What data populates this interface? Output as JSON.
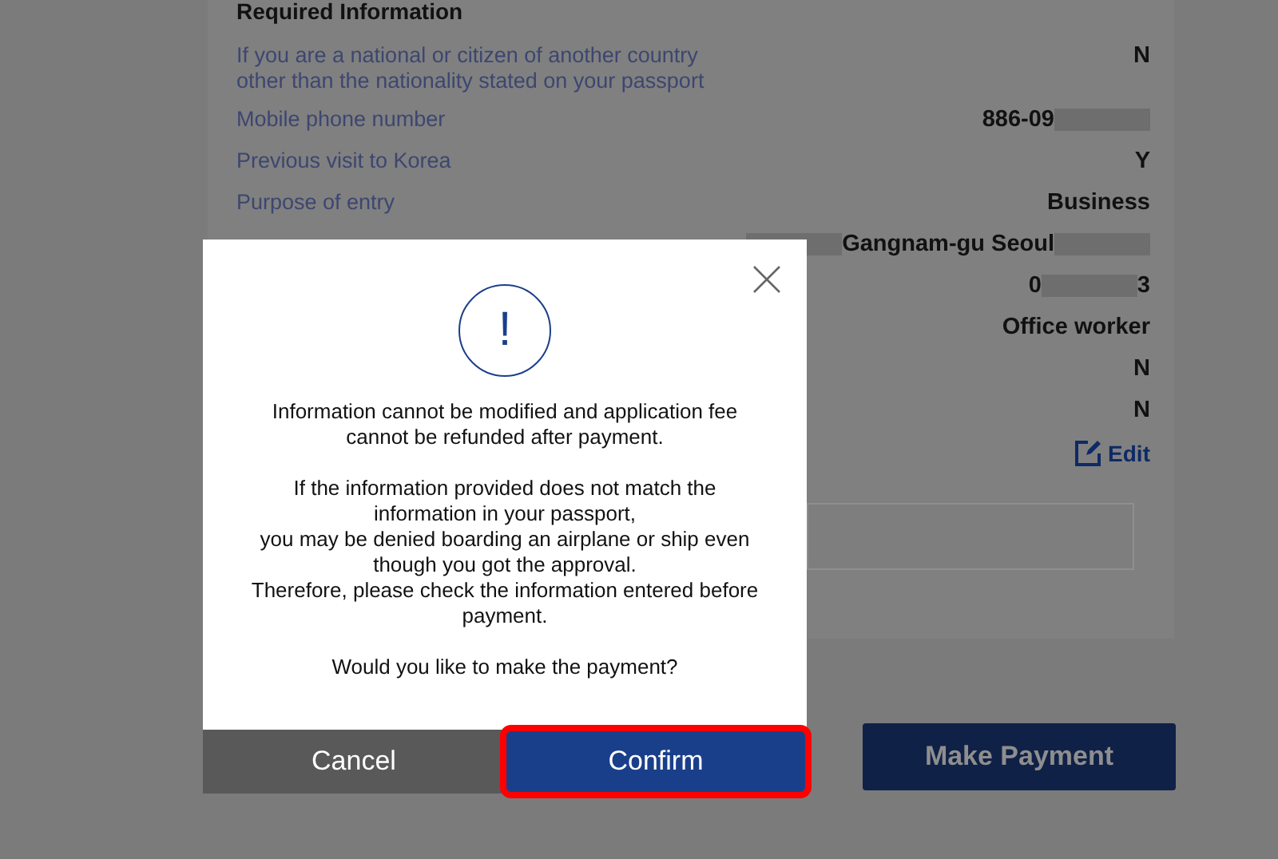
{
  "section": {
    "title": "Required Information",
    "rows": [
      {
        "label": "If you are a national or citizen of another country other than the nationality stated on your passport",
        "value": [
          {
            "kind": "text",
            "text": "N"
          }
        ]
      },
      {
        "label": "Mobile phone number",
        "value": [
          {
            "kind": "text",
            "text": "886-09"
          },
          {
            "kind": "blur"
          }
        ]
      },
      {
        "label": "Previous visit to Korea",
        "value": [
          {
            "kind": "text",
            "text": "Y"
          }
        ]
      },
      {
        "label": "Purpose of entry",
        "value": [
          {
            "kind": "text",
            "text": "Business"
          }
        ]
      },
      {
        "value": [
          {
            "kind": "blur"
          },
          {
            "kind": "text",
            "text": "Gangnam-gu Seoul"
          },
          {
            "kind": "blur"
          }
        ]
      },
      {
        "value": [
          {
            "kind": "text",
            "text": "0"
          },
          {
            "kind": "blur"
          },
          {
            "kind": "text",
            "text": "3"
          }
        ]
      },
      {
        "value": [
          {
            "kind": "text",
            "text": "Office worker"
          }
        ]
      },
      {
        "value": [
          {
            "kind": "text",
            "text": "N"
          }
        ]
      },
      {
        "value": [
          {
            "kind": "text",
            "text": "N"
          }
        ]
      }
    ],
    "edit_link": "Edit"
  },
  "make_payment_button": "Make Payment",
  "dialog": {
    "paragraphs": [
      {
        "lines": [
          "Information cannot be modified and application fee",
          "cannot be refunded after payment."
        ]
      },
      {
        "lines": [
          "If the information provided does not match the",
          "information in your passport,",
          "you may be denied boarding an airplane or ship even",
          "though you got the approval.",
          "Therefore, please check the information entered before",
          "payment."
        ]
      },
      {
        "lines": [
          "Would you like to make the payment?"
        ]
      }
    ],
    "icon_text": "!",
    "buttons": [
      {
        "label": "Cancel",
        "kind": "secondary",
        "highlighted": false
      },
      {
        "label": "Confirm",
        "kind": "primary",
        "highlighted": true
      }
    ]
  }
}
